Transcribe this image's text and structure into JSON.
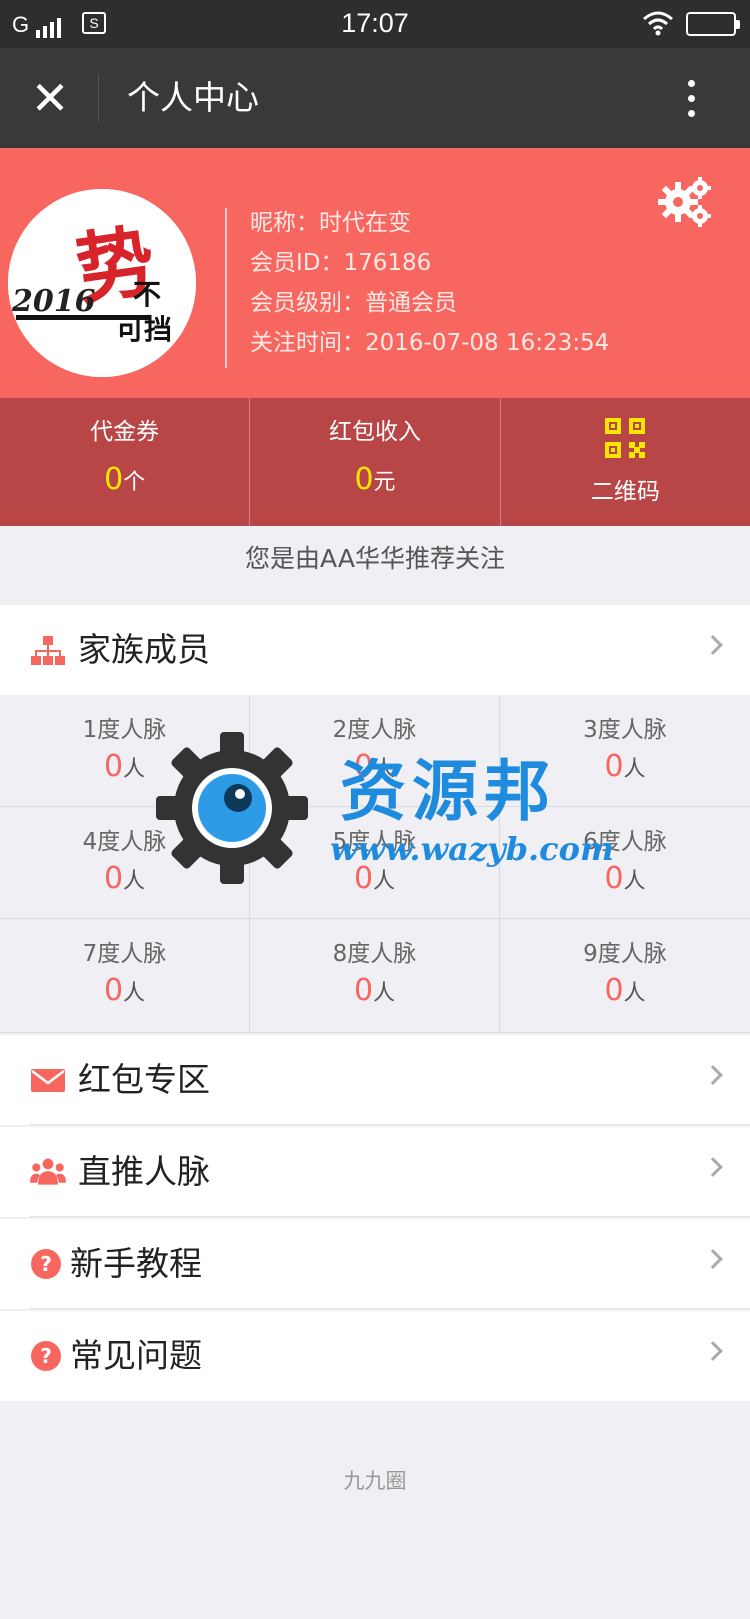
{
  "status_bar": {
    "carrier": "G",
    "sim_label": "S",
    "time": "17:07",
    "icons": [
      "signal-icon",
      "sim-icon",
      "wifi-icon",
      "battery-icon"
    ]
  },
  "nav": {
    "close_icon": "close-icon",
    "title": "个人中心",
    "more_icon": "more-vertical-icon"
  },
  "profile": {
    "avatar_text": "2016 势不可挡",
    "nickname": "昵称：时代在变",
    "member_id": "会员ID：176186",
    "member_level": "会员级别：普通会员",
    "follow_time": "关注时间：2016-07-08 16:23:54",
    "settings_icon": "settings-gear-icon"
  },
  "stats": [
    {
      "label": "代金券",
      "value": "0",
      "unit": "个"
    },
    {
      "label": "红包收入",
      "value": "0",
      "unit": "元"
    },
    {
      "label": "二维码",
      "icon": "qr-code-icon"
    }
  ],
  "referral_text": "您是由AA华华推荐关注",
  "family": {
    "label": "家族成员",
    "icon": "org-chart-icon"
  },
  "network": [
    {
      "label": "1度人脉",
      "value": "0",
      "unit": "人"
    },
    {
      "label": "2度人脉",
      "value": "0",
      "unit": "人"
    },
    {
      "label": "3度人脉",
      "value": "0",
      "unit": "人"
    },
    {
      "label": "4度人脉",
      "value": "0",
      "unit": "人"
    },
    {
      "label": "5度人脉",
      "value": "0",
      "unit": "人"
    },
    {
      "label": "6度人脉",
      "value": "0",
      "unit": "人"
    },
    {
      "label": "7度人脉",
      "value": "0",
      "unit": "人"
    },
    {
      "label": "8度人脉",
      "value": "0",
      "unit": "人"
    },
    {
      "label": "9度人脉",
      "value": "0",
      "unit": "人"
    }
  ],
  "menu": [
    {
      "label": "红包专区",
      "icon": "envelope-icon"
    },
    {
      "label": "直推人脉",
      "icon": "users-icon"
    },
    {
      "label": "新手教程",
      "icon": "question-icon"
    },
    {
      "label": "常见问题",
      "icon": "question-icon"
    }
  ],
  "footer": "九九圈",
  "watermark": {
    "title": "资源邦",
    "url": "www.wazyb.com"
  },
  "colors": {
    "accent": "#f76760",
    "stats_bg": "#b84646",
    "highlight": "#f6e600",
    "nav_bg": "#393939"
  }
}
